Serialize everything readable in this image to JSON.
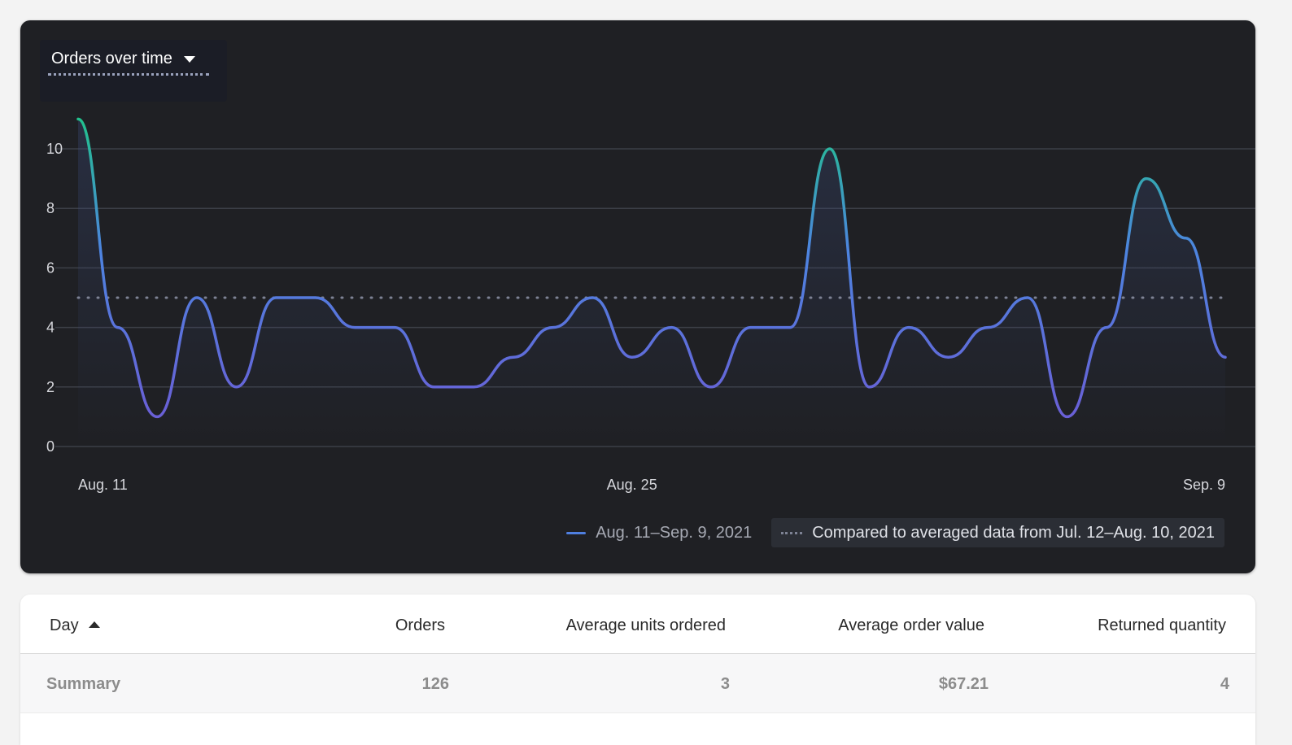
{
  "chart_data": {
    "type": "line",
    "title": "Orders over time",
    "x": [
      "2021-08-11",
      "2021-08-12",
      "2021-08-13",
      "2021-08-14",
      "2021-08-15",
      "2021-08-16",
      "2021-08-17",
      "2021-08-18",
      "2021-08-19",
      "2021-08-20",
      "2021-08-21",
      "2021-08-22",
      "2021-08-23",
      "2021-08-24",
      "2021-08-25",
      "2021-08-26",
      "2021-08-27",
      "2021-08-28",
      "2021-08-29",
      "2021-08-30",
      "2021-08-31",
      "2021-09-01",
      "2021-09-02",
      "2021-09-03",
      "2021-09-04",
      "2021-09-05",
      "2021-09-06",
      "2021-09-07",
      "2021-09-08",
      "2021-09-09"
    ],
    "x_tick_labels": [
      "Aug. 11",
      "Aug. 25",
      "Sep. 9"
    ],
    "series": [
      {
        "name": "Aug. 11–Sep. 9, 2021",
        "values": [
          11,
          4,
          1,
          5,
          2,
          5,
          5,
          4,
          4,
          2,
          2,
          3,
          4,
          5,
          3,
          4,
          2,
          4,
          4,
          10,
          2,
          4,
          3,
          4,
          5,
          1,
          4,
          9,
          7,
          3
        ]
      },
      {
        "name": "Compared to averaged data from Jul. 12–Aug. 10, 2021",
        "style": "dotted",
        "values": [
          5,
          5,
          5,
          5,
          5,
          5,
          5,
          5,
          5,
          5,
          5,
          5,
          5,
          5,
          5,
          5,
          5,
          5,
          5,
          5,
          5,
          5,
          5,
          5,
          5,
          5,
          5,
          5,
          5,
          5
        ]
      }
    ],
    "y_ticks": [
      0,
      2,
      4,
      6,
      8,
      10
    ],
    "ylim": [
      0,
      11
    ],
    "grid": true,
    "legend_position": "bottom-right"
  },
  "legend": {
    "current": "Aug. 11–Sep. 9, 2021",
    "compare": "Compared to averaged data from Jul. 12–Aug. 10, 2021"
  },
  "colors": {
    "background": "#1f2024",
    "line_low": "#6a5fd6",
    "line_mid": "#4d84e0",
    "line_high": "#20c48a",
    "compare_line": "#7d8294"
  },
  "table": {
    "columns": [
      "Day",
      "Orders",
      "Average units ordered",
      "Average order value",
      "Returned quantity"
    ],
    "sort": "ascending",
    "summary": [
      "Summary",
      "126",
      "3",
      "$67.21",
      "4"
    ]
  }
}
